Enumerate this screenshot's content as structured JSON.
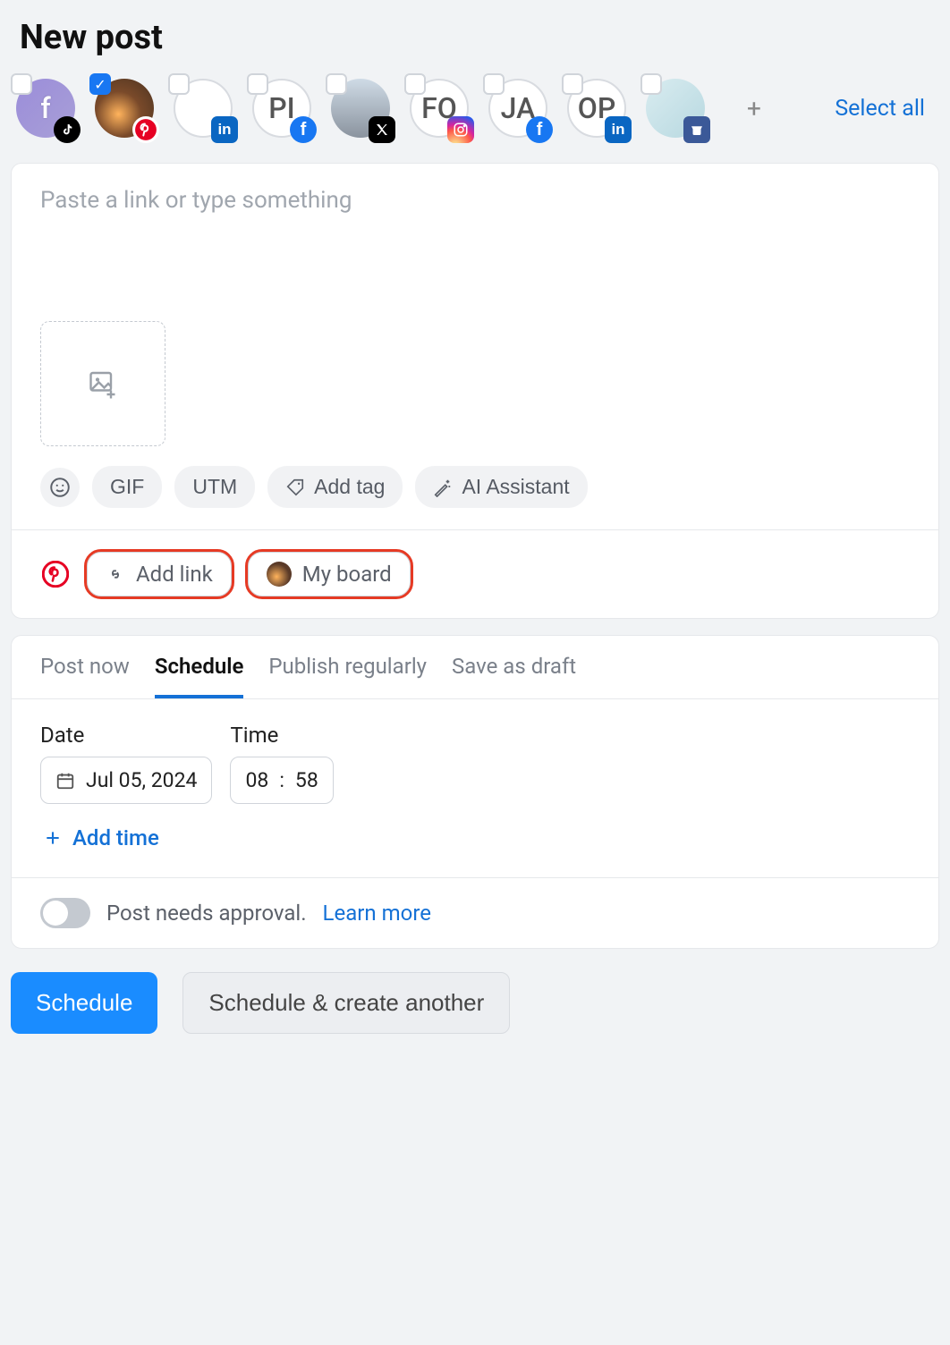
{
  "header": {
    "title": "New post",
    "select_all": "Select all"
  },
  "accounts": [
    {
      "id": "acct-tiktok",
      "initials": "f",
      "avatar_style": "purple",
      "network": "tiktok",
      "checked": false
    },
    {
      "id": "acct-pinterest",
      "initials": "",
      "avatar_style": "sunset",
      "network": "pinterest",
      "checked": true
    },
    {
      "id": "acct-linkedin-1",
      "initials": "",
      "avatar_style": "blank",
      "network": "linkedin",
      "checked": false
    },
    {
      "id": "acct-facebook-1",
      "initials": "PI",
      "avatar_style": "lettered",
      "network": "facebook",
      "checked": false
    },
    {
      "id": "acct-x",
      "initials": "",
      "avatar_style": "hooded",
      "network": "x",
      "checked": false
    },
    {
      "id": "acct-instagram",
      "initials": "FO",
      "avatar_style": "lettered",
      "network": "instagram",
      "checked": false
    },
    {
      "id": "acct-facebook-2",
      "initials": "JA",
      "avatar_style": "lettered",
      "network": "facebook",
      "checked": false
    },
    {
      "id": "acct-linkedin-2",
      "initials": "OP",
      "avatar_style": "lettered",
      "network": "linkedin",
      "checked": false
    },
    {
      "id": "acct-google",
      "initials": "",
      "avatar_style": "paint",
      "network": "google",
      "checked": false
    }
  ],
  "composer": {
    "placeholder": "Paste a link or type something"
  },
  "tools": {
    "gif": "GIF",
    "utm": "UTM",
    "add_tag": "Add tag",
    "ai": "AI Assistant"
  },
  "pinterest_row": {
    "add_link": "Add link",
    "board": "My board"
  },
  "tabs": {
    "post_now": "Post now",
    "schedule": "Schedule",
    "publish_regularly": "Publish regularly",
    "save_draft": "Save as draft",
    "active": "schedule"
  },
  "schedule": {
    "date_label": "Date",
    "time_label": "Time",
    "date_value": "Jul 05, 2024",
    "hour": "08",
    "minute": "58",
    "add_time": "Add time"
  },
  "approval": {
    "text": "Post needs approval.",
    "learn_more": "Learn more",
    "enabled": false
  },
  "footer": {
    "schedule": "Schedule",
    "schedule_another": "Schedule & create another"
  }
}
